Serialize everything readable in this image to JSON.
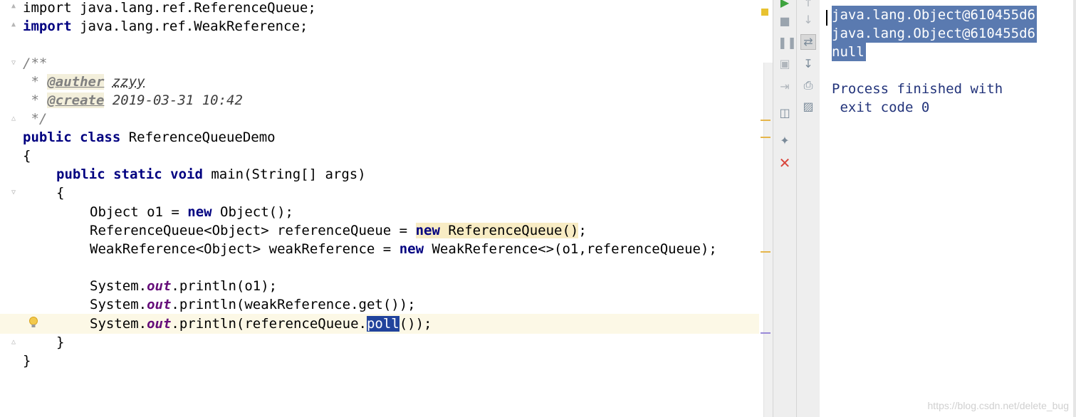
{
  "editor": {
    "lines": {
      "import1": "import java.lang.ref.ReferenceQueue;",
      "import2_kw": "import",
      "import2_rest": " java.lang.ref.WeakReference;",
      "doc_open": "/**",
      "doc_star1": " * ",
      "auther_tag": "@auther",
      "auther_val": "zzyy",
      "doc_star2": " * ",
      "create_tag": "@create",
      "create_val": "2019-03-31 10:42",
      "doc_close": " */",
      "class_kw": "public class",
      "class_name": " ReferenceQueueDemo",
      "brace_open": "{",
      "main_kw": "public static void",
      "main_rest": " main(String[] args)",
      "main_brace": "{",
      "l1_a": "Object o1 = ",
      "l1_kw": "new",
      "l1_b": " Object();",
      "l2_a": "ReferenceQueue<Object> referenceQueue = ",
      "l2_kw": "new",
      "l2_b": " ReferenceQueue()",
      "l2_c": ";",
      "l3_a": "WeakReference<Object> weakReference = ",
      "l3_kw": "new",
      "l3_b": " WeakReference<>(o1,referenceQueue);",
      "p1_a": "System.",
      "p1_field": "out",
      "p1_b": ".println(o1);",
      "p2_a": "System.",
      "p2_field": "out",
      "p2_b": ".println(weakReference.get());",
      "p3_a": "System.",
      "p3_field": "out",
      "p3_b": ".println(referenceQueue.",
      "p3_sel": "poll",
      "p3_c": "());",
      "main_close": "}",
      "class_close": "}"
    }
  },
  "console": {
    "lines": [
      "java.lang.Object@610455d6",
      "java.lang.Object@610455d6",
      "null"
    ],
    "process_line1": "Process finished with",
    "process_line2": " exit code 0"
  },
  "watermark": "https://blog.csdn.net/delete_bug",
  "colors": {
    "keyword": "#000080",
    "selection": "#21439c",
    "console_selection": "#5a7ab0",
    "stripe_mark": "#e6b64b"
  },
  "icons": {
    "toolbar1": [
      "run-icon",
      "stop-icon",
      "pause-icon",
      "camera-icon",
      "login-icon",
      "layout-icon",
      "pin-icon",
      "close-icon"
    ],
    "toolbar2": [
      "up-arrow-icon",
      "down-arrow-icon",
      "wrap-icon",
      "scroll-to-end-icon",
      "print-icon",
      "trash-icon"
    ]
  }
}
